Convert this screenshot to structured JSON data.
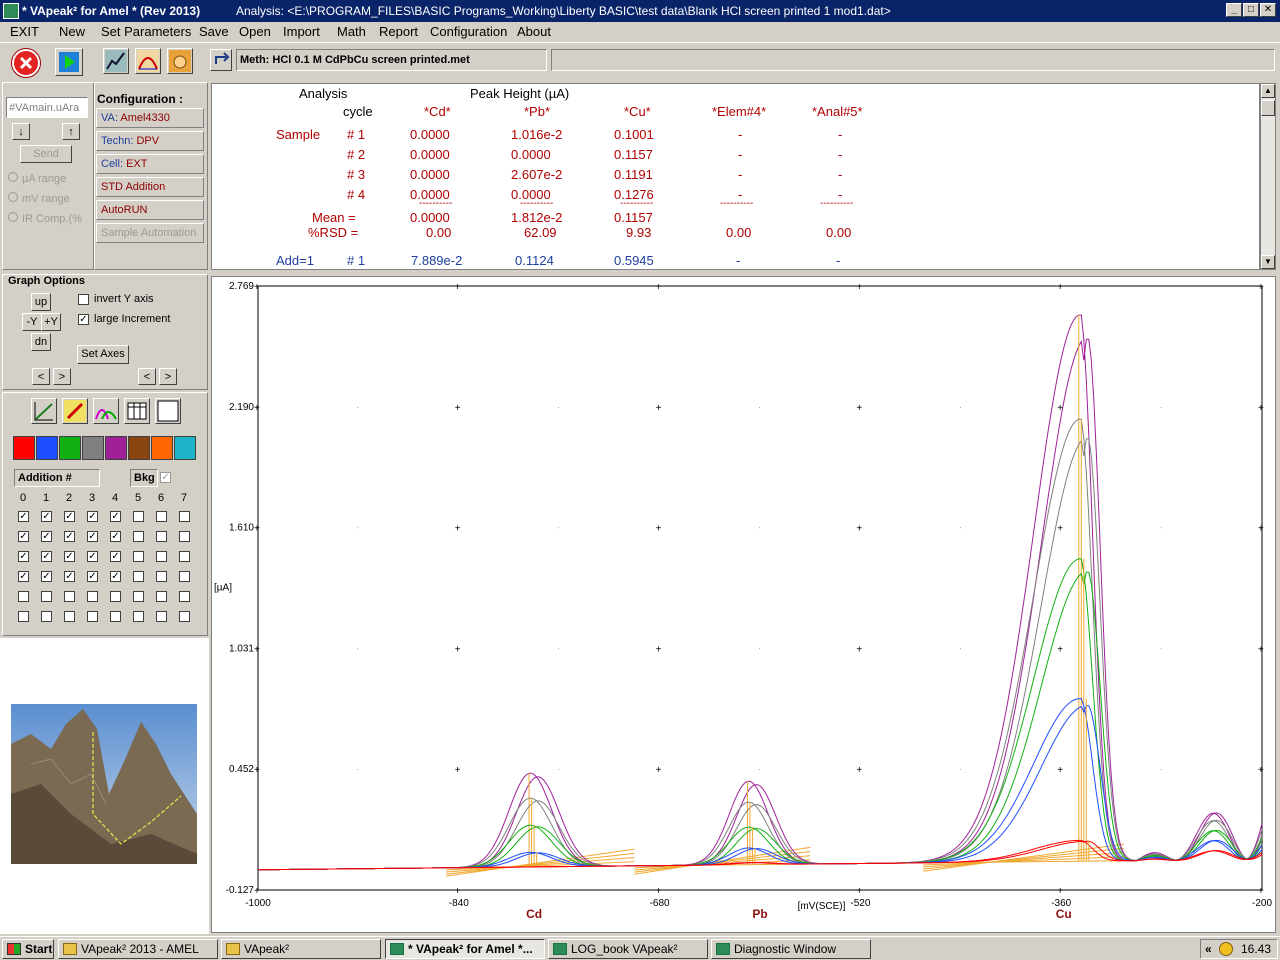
{
  "window": {
    "title": "* VApeak² for Amel *  (Rev 2013)",
    "analysis_path": "Analysis: <E:\\PROGRAM_FILES\\BASIC Programs_Working\\Liberty BASIC\\test data\\Blank HCl screen printed 1 mod1.dat>",
    "min": "_",
    "max": "□",
    "close": "✕"
  },
  "menu": [
    "EXIT",
    "New",
    "Set Parameters",
    "Save",
    "Open",
    "Import",
    "Math",
    "Report",
    "Configuration",
    "About"
  ],
  "toolbar": {
    "method": "Meth: HCl 0.1 M CdPbCu screen printed.met"
  },
  "left": {
    "command_input": "#VAmain.uAra",
    "send": "Send",
    "ranges": [
      "µA range",
      "mV range",
      "IR Comp.(%"
    ],
    "config_title": "Configuration :",
    "config": [
      {
        "label": "VA:",
        "value": "Amel4330"
      },
      {
        "label": "Techn:",
        "value": "DPV"
      },
      {
        "label": "Cell:",
        "value": "EXT"
      },
      {
        "label": "STD Addition",
        "value": ""
      },
      {
        "label": "AutoRUN",
        "value": ""
      },
      {
        "label": "Sample Automation",
        "value": ""
      }
    ],
    "graph_options": "Graph Options",
    "up": "up",
    "dn": "dn",
    "minus_y": "-Y",
    "plus_y": "+Y",
    "invert_y": "invert Y axis",
    "large_increment": "large Increment",
    "set_axes": "Set Axes",
    "lt": "<",
    "gt": ">",
    "addition": "Addition #",
    "bkg": "Bkg",
    "cols": [
      "0",
      "1",
      "2",
      "3",
      "4",
      "5",
      "6",
      "7"
    ],
    "swatches": [
      "#ff0000",
      "#1e4fff",
      "#12b012",
      "#808080",
      "#a0209a",
      "#8b4513",
      "#ff6600",
      "#1eb4c8"
    ]
  },
  "results": {
    "analysis": "Analysis",
    "peak_height": "Peak Height (µA)",
    "cycle": "cycle",
    "columns": [
      "*Cd*",
      "*Pb*",
      "*Cu*",
      "*Elem#4*",
      "*Anal#5*"
    ],
    "sample_label": "Sample",
    "rows": [
      {
        "cycle": "# 1",
        "vals": [
          "0.0000",
          "1.016e-2",
          "0.1001",
          "-",
          "-"
        ]
      },
      {
        "cycle": "# 2",
        "vals": [
          "0.0000",
          "0.0000",
          "0.1157",
          "-",
          "-"
        ]
      },
      {
        "cycle": "# 3",
        "vals": [
          "0.0000",
          "2.607e-2",
          "0.1191",
          "-",
          "-"
        ]
      },
      {
        "cycle": "# 4",
        "vals": [
          "0.0000",
          "0.0000",
          "0.1276",
          "-",
          "-"
        ]
      }
    ],
    "dash": "----------",
    "mean_label": "Mean =",
    "mean": [
      "0.0000",
      "1.812e-2",
      "0.1157"
    ],
    "rsd_label": "%RSD =",
    "rsd": [
      "0.00",
      "62.09",
      "9.93",
      "0.00",
      "0.00"
    ],
    "add_label": "Add=1",
    "add_cycle": "# 1",
    "add": [
      "7.889e-2",
      "0.1124",
      "0.5945",
      "-",
      "-"
    ]
  },
  "chart_data": {
    "type": "line",
    "xlabel": "[mV(SCE)]",
    "ylabel": "[µA]",
    "xlim": [
      -1000,
      -200
    ],
    "ylim": [
      -0.127,
      2.769
    ],
    "xticks": [
      "-1000",
      "-840",
      "-680",
      "-520",
      "-360",
      "-200"
    ],
    "yticks": [
      "2.769",
      "2.190",
      "1.610",
      "1.031",
      "0.452",
      "-0.127"
    ],
    "peak_labels": [
      {
        "text": "Cd",
        "x": -780
      },
      {
        "text": "Pb",
        "x": -600
      },
      {
        "text": "Cu",
        "x": -358
      }
    ],
    "series": [
      {
        "color": "#a0209a",
        "peaks": [
          0.45,
          0.4,
          2.62
        ]
      },
      {
        "color": "#808080",
        "peaks": [
          0.33,
          0.3,
          2.12
        ]
      },
      {
        "color": "#12b012",
        "peaks": [
          0.2,
          0.18,
          1.45
        ]
      },
      {
        "color": "#1e4fff",
        "peaks": [
          0.07,
          0.08,
          0.78
        ]
      },
      {
        "color": "#ff0000",
        "peaks": [
          0.0,
          0.01,
          0.1
        ]
      }
    ]
  },
  "taskbar": {
    "start": "Start",
    "tasks": [
      "VApeak² 2013 - AMEL",
      "VApeak²",
      "* VApeak² for Amel *...",
      "LOG_book    VApeak²",
      "Diagnostic Window"
    ],
    "time": "16.43",
    "chev": "«"
  }
}
